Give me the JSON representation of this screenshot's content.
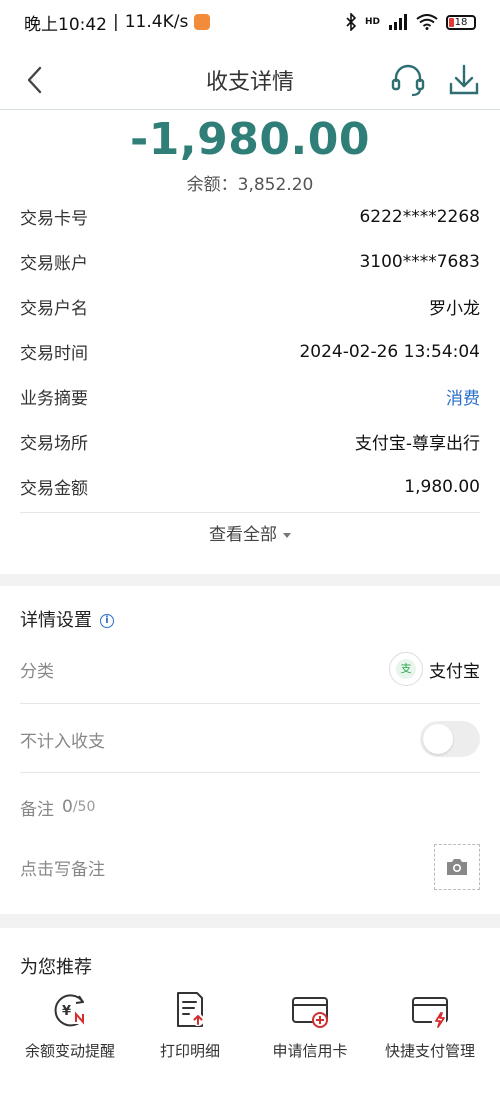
{
  "status_bar": {
    "time": "晚上10:42",
    "separator": "|",
    "speed": "11.4K/s",
    "hd_label": "HD",
    "battery": "18"
  },
  "nav": {
    "title": "收支详情",
    "back_icon": "back-chevron-icon",
    "service_icon": "headset-icon",
    "download_icon": "download-icon"
  },
  "summary": {
    "amount": "-1,980.00",
    "balance_label": "余额：",
    "balance_value": "3,852.20"
  },
  "details": [
    {
      "label": "交易卡号",
      "value": "6222****2268"
    },
    {
      "label": "交易账户",
      "value": "3100****7683"
    },
    {
      "label": "交易户名",
      "value": "罗小龙"
    },
    {
      "label": "交易时间",
      "value": "2024-02-26 13:54:04"
    },
    {
      "label": "业务摘要",
      "value": "消费"
    },
    {
      "label": "交易场所",
      "value": "支付宝-尊享出行"
    },
    {
      "label": "交易金额",
      "value": "1,980.00"
    }
  ],
  "view_all": "查看全部",
  "settings": {
    "title": "详情设置",
    "info_glyph": "i",
    "category_label": "分类",
    "category_value": "支付宝",
    "category_icon_glyph": "支",
    "exclude_label": "不计入收支",
    "exclude_on": false,
    "note_label": "备注",
    "note_count": "0",
    "note_max": "/50",
    "note_placeholder": "点击写备注"
  },
  "recommend": {
    "title": "为您推荐",
    "items": [
      {
        "label": "余额变动提醒",
        "icon": "balance-alert-icon"
      },
      {
        "label": "打印明细",
        "icon": "print-detail-icon"
      },
      {
        "label": "申请信用卡",
        "icon": "apply-card-icon"
      },
      {
        "label": "快捷支付管理",
        "icon": "quick-pay-icon"
      }
    ]
  },
  "colors": {
    "accent": "#2f7f78",
    "link": "#2a6fc7",
    "alert_red": "#d32f2f"
  }
}
